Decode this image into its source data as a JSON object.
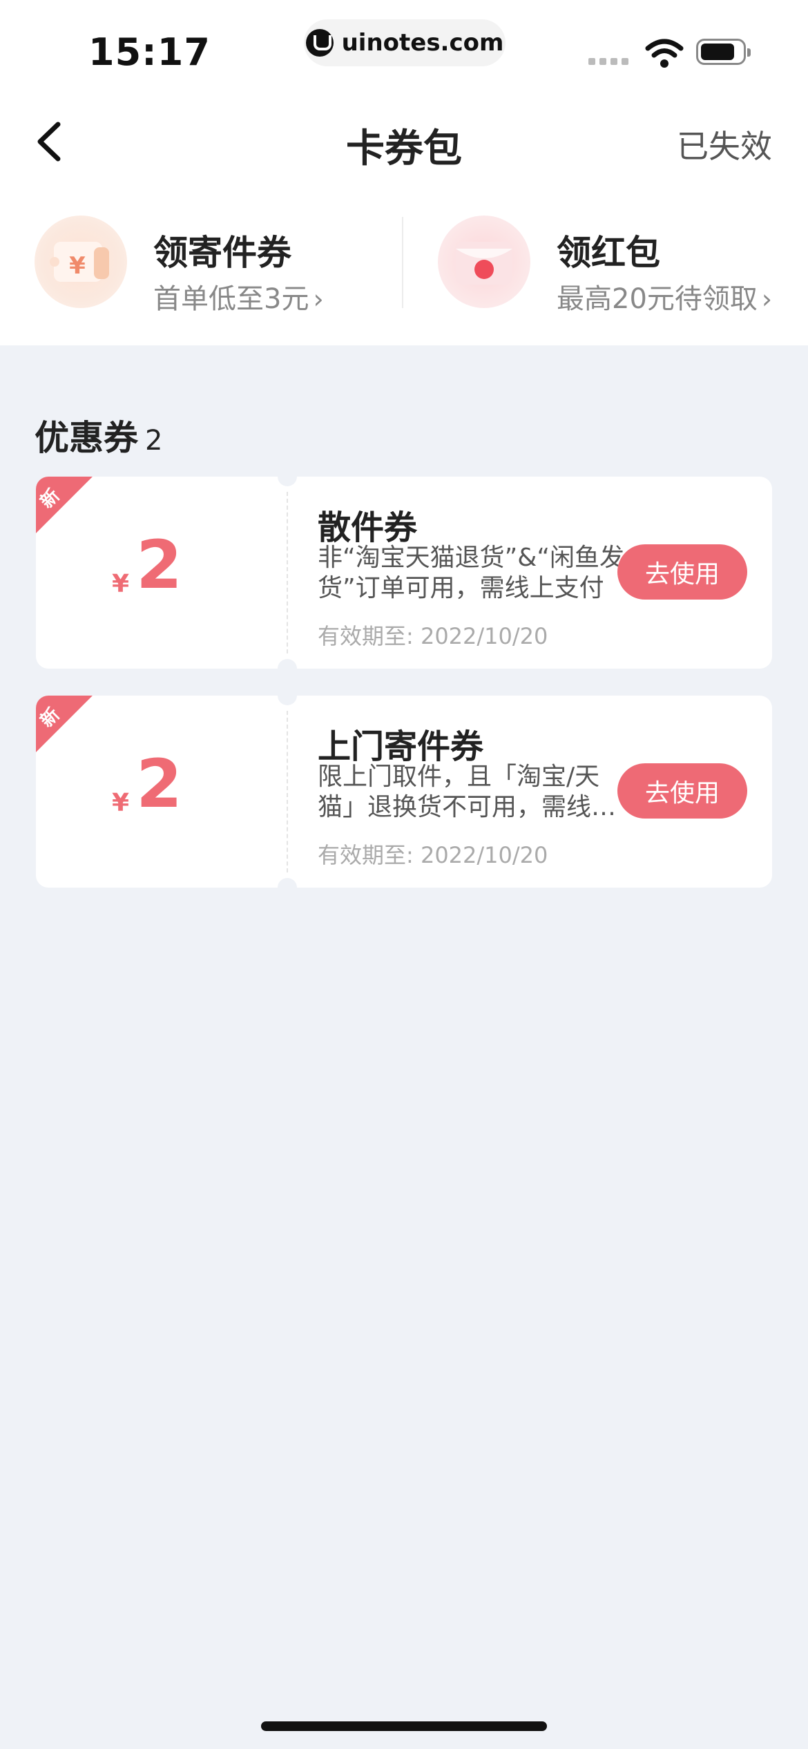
{
  "status_bar": {
    "time": "15:17",
    "url": "uinotes.com"
  },
  "nav": {
    "title": "卡券包",
    "right_link": "已失效"
  },
  "promos": [
    {
      "title": "领寄件券",
      "subtitle": "首单低至3元",
      "icon": "coupon-icon"
    },
    {
      "title": "领红包",
      "subtitle": "最高20元待领取",
      "icon": "red-packet-icon"
    }
  ],
  "section": {
    "title": "优惠券",
    "count": "2"
  },
  "coupons": [
    {
      "badge": "新",
      "currency": "¥",
      "amount": "2",
      "name": "散件券",
      "desc": "非“淘宝天猫退货”&“闲鱼发货”订单可用，需线上支付",
      "expiry": "有效期至: 2022/10/20",
      "button": "去使用"
    },
    {
      "badge": "新",
      "currency": "¥",
      "amount": "2",
      "name": "上门寄件券",
      "desc": "限上门取件，且「淘宝/天猫」退换货不可用，需线…",
      "expiry": "有效期至: 2022/10/20",
      "button": "去使用"
    }
  ],
  "colors": {
    "accent": "#ee6a75",
    "background": "#eff2f7"
  }
}
